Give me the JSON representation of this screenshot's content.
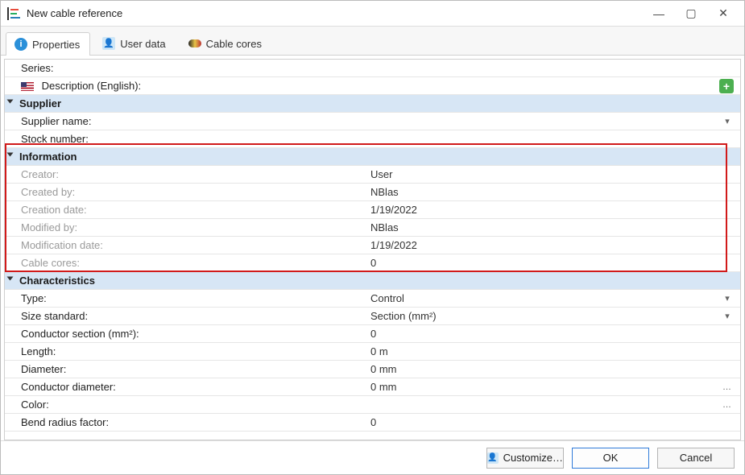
{
  "window": {
    "title": "New cable reference"
  },
  "tabs": {
    "properties": "Properties",
    "user_data": "User data",
    "cable_cores": "Cable cores"
  },
  "groups": {
    "supplier": "Supplier",
    "information": "Information",
    "characteristics": "Characteristics"
  },
  "rows": {
    "series": {
      "label": "Series:",
      "value": ""
    },
    "description": {
      "label": "Description (English):",
      "value": ""
    },
    "supplier_name": {
      "label": "Supplier name:",
      "value": ""
    },
    "stock_number": {
      "label": "Stock number:",
      "value": ""
    },
    "creator": {
      "label": "Creator:",
      "value": "User"
    },
    "created_by": {
      "label": "Created by:",
      "value": "NBlas"
    },
    "creation_date": {
      "label": "Creation date:",
      "value": "1/19/2022"
    },
    "modified_by": {
      "label": "Modified by:",
      "value": "NBlas"
    },
    "modification_date": {
      "label": "Modification date:",
      "value": "1/19/2022"
    },
    "cable_cores": {
      "label": "Cable cores:",
      "value": "0"
    },
    "type": {
      "label": "Type:",
      "value": "Control"
    },
    "size_standard": {
      "label": "Size standard:",
      "value": "Section (mm²)"
    },
    "conductor_section": {
      "label": "Conductor section (mm²):",
      "value": "0"
    },
    "length": {
      "label": "Length:",
      "value": "0 m"
    },
    "diameter": {
      "label": "Diameter:",
      "value": "0 mm"
    },
    "conductor_diameter": {
      "label": "Conductor diameter:",
      "value": "0 mm"
    },
    "color": {
      "label": "Color:",
      "value": ""
    },
    "bend_radius": {
      "label": "Bend radius factor:",
      "value": "0"
    }
  },
  "footer": {
    "customize": "Customize…",
    "ok": "OK",
    "cancel": "Cancel"
  }
}
